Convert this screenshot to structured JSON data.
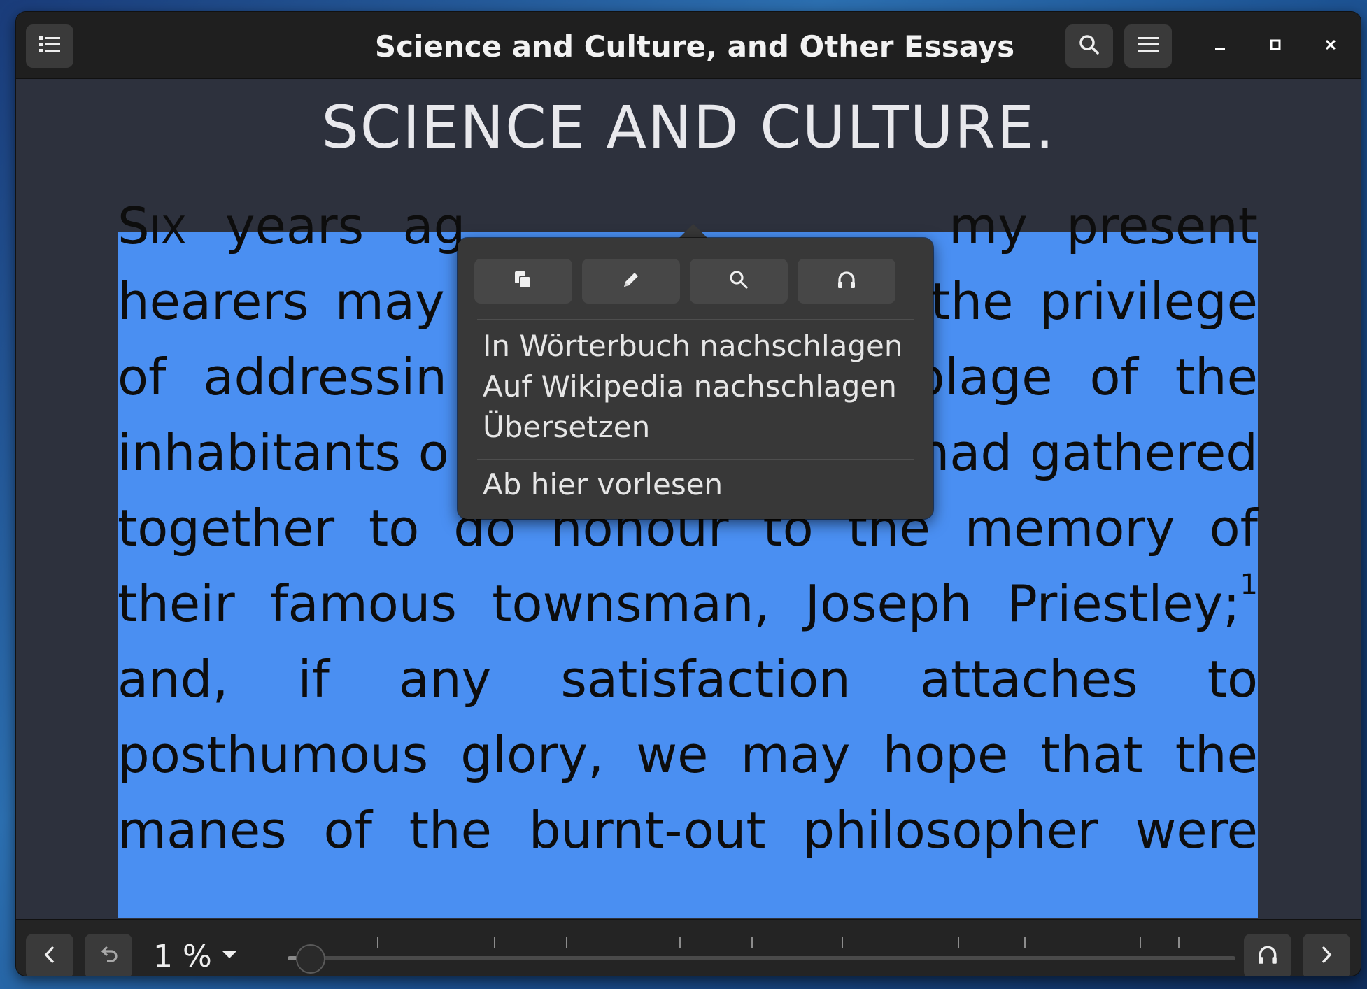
{
  "headerbar": {
    "title": "Science and Culture, and Other Essays",
    "toc_icon": "list-icon",
    "search_icon": "search-icon",
    "menu_icon": "hamburger-menu-icon",
    "minimize_glyph": "–",
    "maximize_glyph": "▫",
    "close_glyph": "✕"
  },
  "document": {
    "chapter_title": "SCIENCE AND CULTURE.",
    "selection_color": "#4a8ff2",
    "lines": [
      [
        "Six",
        "years",
        "ag",
        "my",
        "present"
      ],
      [
        "hearers",
        "may",
        "the",
        "privilege"
      ],
      [
        "of",
        "addressin",
        "blage",
        "of",
        "the"
      ],
      [
        "inhabitants",
        "o",
        "had",
        "gathered"
      ],
      [
        "together",
        "to",
        "do",
        "honour",
        "to",
        "the",
        "memory",
        "of"
      ],
      [
        "their",
        "famous",
        "townsman,",
        "Joseph",
        "Priestley;"
      ],
      [
        "and,",
        "if",
        "any",
        "satisfaction",
        "attaches",
        "to"
      ],
      [
        "posthumous",
        "glory,",
        "we",
        "may",
        "hope",
        "that",
        "the"
      ],
      [
        "manes",
        "of",
        "the",
        "burnt-out",
        "philosopher",
        "were"
      ]
    ],
    "footnote_marker": "1"
  },
  "popover": {
    "buttons": [
      {
        "icon": "copy-icon"
      },
      {
        "icon": "pencil-icon"
      },
      {
        "icon": "search-icon"
      },
      {
        "icon": "headphones-icon"
      }
    ],
    "items": [
      "In Wörterbuch nachschlagen",
      "Auf Wikipedia nachschlagen",
      "Übersetzen"
    ],
    "read_aloud": "Ab hier vorlesen"
  },
  "bottombar": {
    "prev_icon": "chevron-left-icon",
    "back_icon": "undo-arrow-icon",
    "progress_label": "1 %",
    "progress_fraction": 0.01,
    "narration_icon": "headphones-icon",
    "next_icon": "chevron-right-icon"
  }
}
